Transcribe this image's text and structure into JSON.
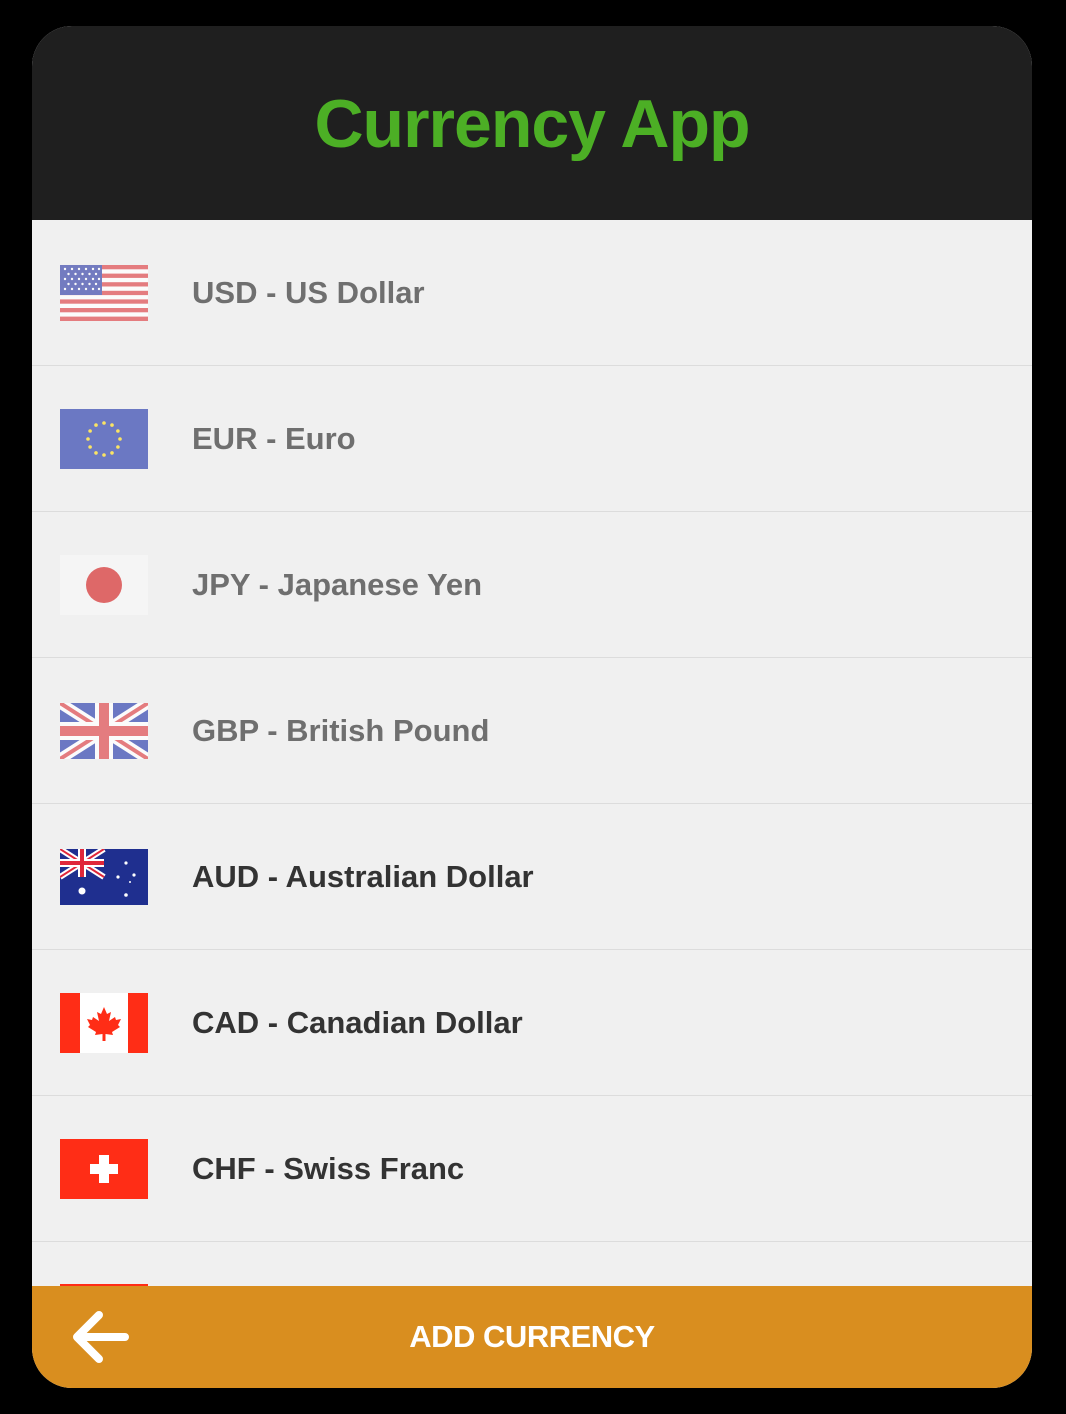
{
  "app": {
    "title": "Currency App"
  },
  "currencies": [
    {
      "label": "USD - US Dollar",
      "flag": "us-flag-icon"
    },
    {
      "label": "EUR - Euro",
      "flag": "eu-flag-icon"
    },
    {
      "label": "JPY - Japanese Yen",
      "flag": "jp-flag-icon"
    },
    {
      "label": "GBP - British Pound",
      "flag": "gb-flag-icon"
    },
    {
      "label": "AUD - Australian Dollar",
      "flag": "au-flag-icon"
    },
    {
      "label": "CAD - Canadian Dollar",
      "flag": "ca-flag-icon"
    },
    {
      "label": "CHF - Swiss Franc",
      "flag": "ch-flag-icon"
    }
  ],
  "bottom_bar": {
    "action_label": "ADD CURRENCY",
    "back_icon": "arrow-left-icon"
  },
  "colors": {
    "header_bg": "#1f1f1f",
    "title": "#4caf25",
    "list_bg": "#f0f0f0",
    "bottom_bar": "#d98e1f",
    "text_dark": "#333333",
    "text_faded": "#6f6f6f"
  }
}
